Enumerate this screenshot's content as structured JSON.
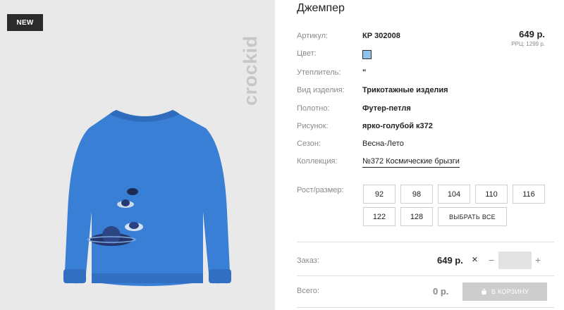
{
  "photo": {
    "badge": "NEW",
    "brand": "crockid"
  },
  "product": {
    "title": "Джемпер",
    "price": "649 р.",
    "rrp": "РРЦ: 1299 р."
  },
  "specs": {
    "article": {
      "label": "Артикул:",
      "value": "КР 302008"
    },
    "color": {
      "label": "Цвет:",
      "swatch": "#8ec3ea"
    },
    "insulation": {
      "label": "Утеплитель:",
      "value": "\""
    },
    "type": {
      "label": "Вид изделия:",
      "value": "Трикотажные изделия"
    },
    "fabric": {
      "label": "Полотно:",
      "value": "Футер-петля"
    },
    "print": {
      "label": "Рисунок:",
      "value": "ярко-голубой к372"
    },
    "season": {
      "label": "Сезон:",
      "value": "Весна-Лето"
    },
    "collection": {
      "label": "Коллекция:",
      "value": "№372 Космические брызги"
    }
  },
  "sizes": {
    "label": "Рост/размер:",
    "items": [
      "92",
      "98",
      "104",
      "110",
      "116",
      "122",
      "128"
    ],
    "select_all": "ВЫБРАТЬ ВСЕ"
  },
  "order": {
    "label": "Заказ:",
    "price": "649 р.",
    "times": "×",
    "minus": "−",
    "plus": "+",
    "quantity": ""
  },
  "total": {
    "label": "Всего:",
    "value": "0 р.",
    "cart_button": "В КОРЗИНУ"
  }
}
